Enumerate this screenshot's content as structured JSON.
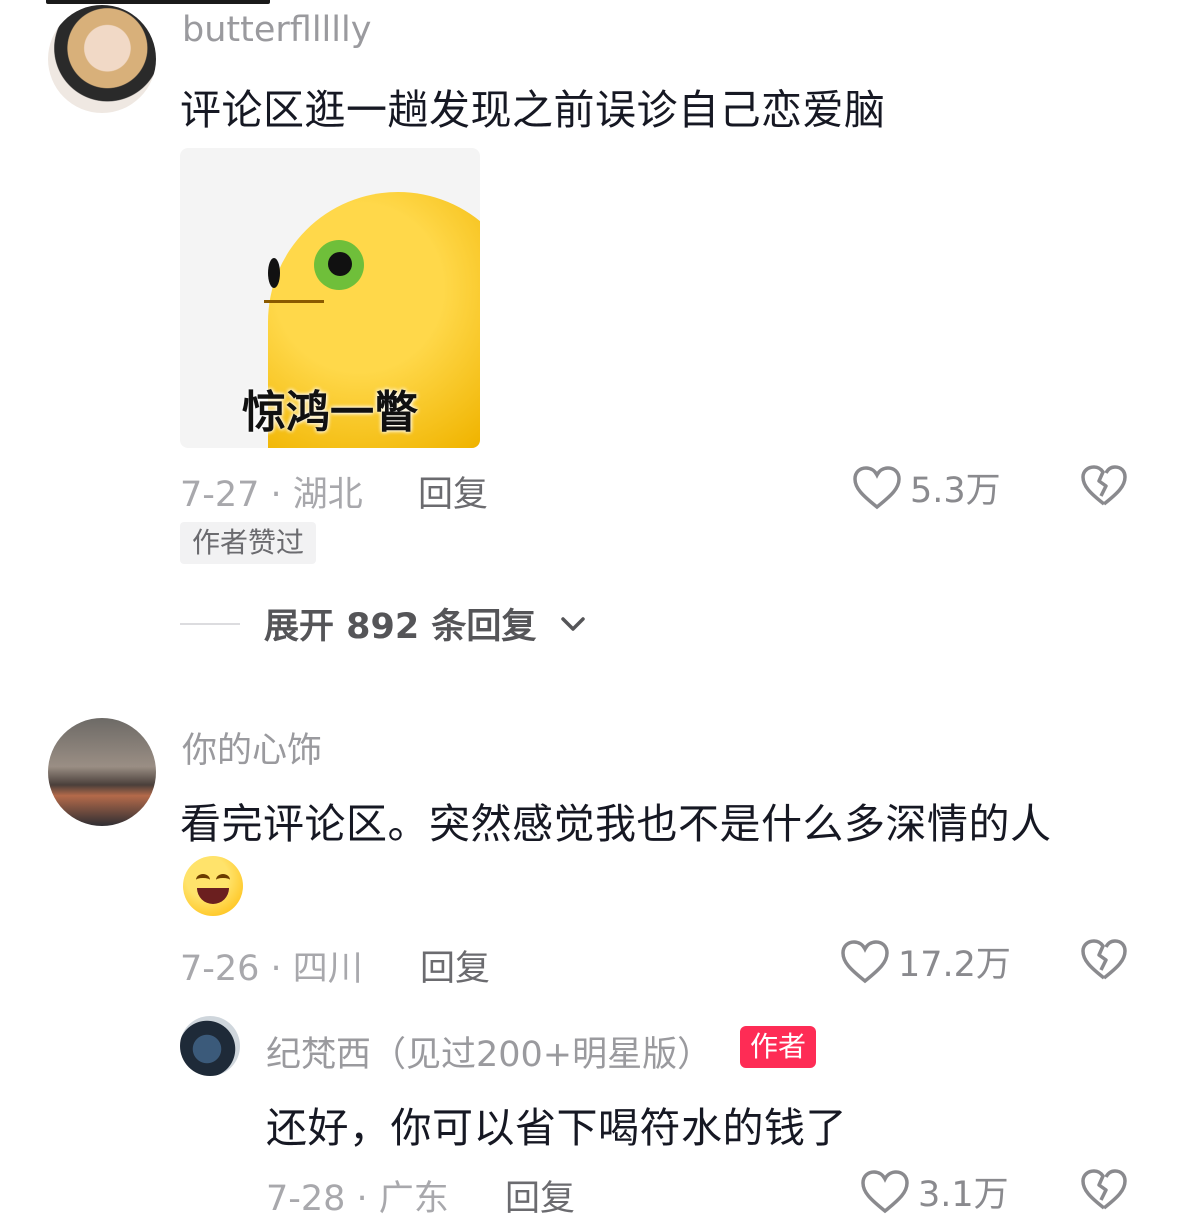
{
  "comments": [
    {
      "username": "butterfllllly",
      "text": "评论区逛一趟发现之前误诊自己恋爱脑",
      "sticker_caption": "惊鸿一瞥",
      "date_location": "7-27 · 湖北",
      "reply_label": "回复",
      "likes": "5.3万",
      "badge": "作者赞过",
      "expand_label": "展开 892 条回复"
    },
    {
      "username": "你的心饰",
      "text": "看完评论区。突然感觉我也不是什么多深情的人",
      "emoji": "grinning-face-emoji",
      "date_location": "7-26 · 四川",
      "reply_label": "回复",
      "likes": "17.2万"
    }
  ],
  "reply": {
    "username": "纪梵西（见过200+明星版）",
    "author_badge": "作者",
    "text": "还好，你可以省下喝符水的钱了",
    "date_location": "7-28 · 广东",
    "reply_label": "回复",
    "likes": "3.1万"
  },
  "colors": {
    "accent": "#fe2c55",
    "muted": "#a8a8ac",
    "text": "#161823"
  }
}
